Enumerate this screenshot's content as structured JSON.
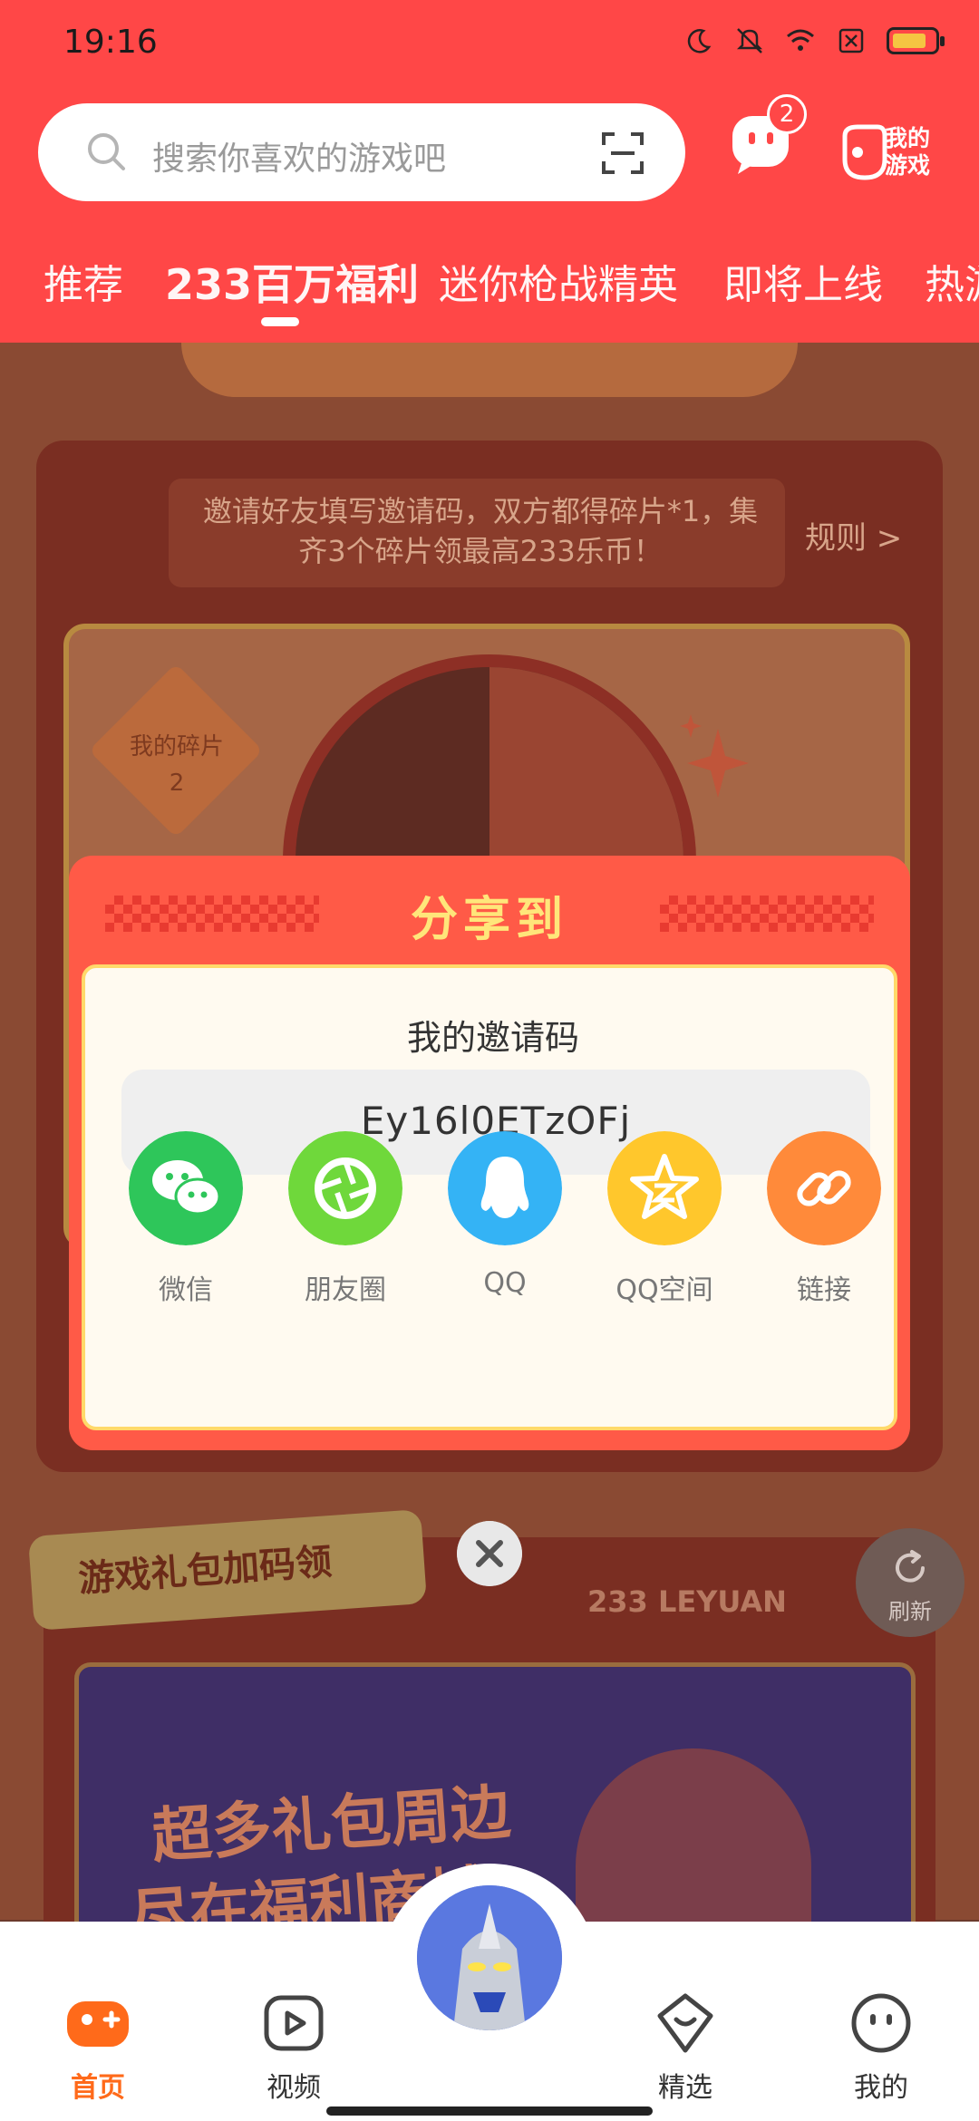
{
  "status_bar": {
    "time": "19:16",
    "icons": [
      "moon-icon",
      "mute-icon",
      "wifi-icon",
      "sim-icon",
      "battery-icon"
    ]
  },
  "header": {
    "search_placeholder": "搜索你喜欢的游戏吧",
    "message_badge": "2",
    "my_games_label": "我的游戏",
    "tabs": [
      "推荐",
      "233百万福利",
      "迷你枪战精英",
      "即将上线",
      "热游"
    ],
    "active_tab": "233百万福利"
  },
  "background": {
    "rule_text": "邀请好友填写邀请码，双方都得碎片*1，集齐3个碎片领最高233乐币！",
    "rule_link": "规则 >",
    "my_fragments_label": "我的碎片",
    "my_fragments_count": "2",
    "gift_tag": "游戏礼包加码领",
    "leyuan": "233 LEYUAN",
    "promo_line1": "超多礼包周边",
    "promo_line2": "尽在福利商城",
    "refresh_label": "刷新"
  },
  "modal": {
    "title": "分享到",
    "invite_label": "我的邀请码",
    "invite_code": "Ey16l0ETzOFj",
    "share_options": [
      {
        "label": "微信",
        "icon": "wechat-icon",
        "color": "#2ec65a"
      },
      {
        "label": "朋友圈",
        "icon": "moments-icon",
        "color": "#6fd83b"
      },
      {
        "label": "QQ",
        "icon": "qq-icon",
        "color": "#34b3f5"
      },
      {
        "label": "QQ空间",
        "icon": "qzone-icon",
        "color": "#ffc72c"
      },
      {
        "label": "链接",
        "icon": "link-icon",
        "color": "#ff8a3a"
      }
    ]
  },
  "bottom_nav": {
    "items": [
      {
        "label": "首页",
        "icon": "home-gamepad-icon",
        "active": true
      },
      {
        "label": "视频",
        "icon": "video-icon",
        "active": false
      },
      {
        "label": "精选",
        "icon": "featured-icon",
        "active": false
      },
      {
        "label": "我的",
        "icon": "profile-icon",
        "active": false
      }
    ]
  },
  "colors": {
    "brand_red": "#ff4747",
    "active_orange": "#ff6a1a",
    "modal_red": "#ff5a47",
    "title_yellow": "#ffe67a"
  }
}
